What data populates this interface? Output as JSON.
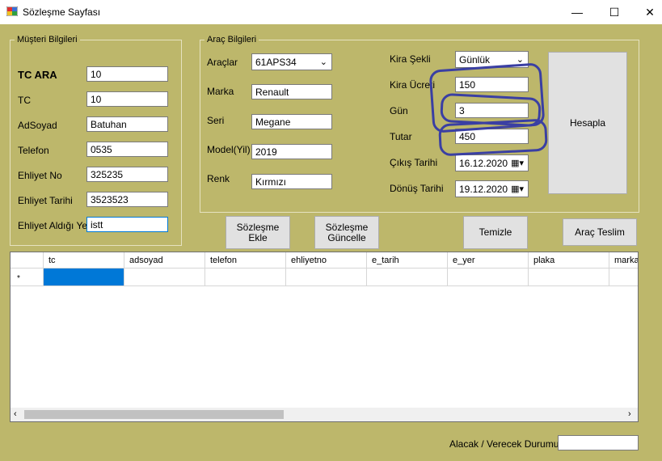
{
  "window": {
    "title": "Sözleşme Sayfası",
    "minimize": "—",
    "maximize": "☐",
    "close": "✕"
  },
  "musteri": {
    "group_label": "Müşteri Bilgileri",
    "tc_ara_label": "TC ARA",
    "tc_ara_value": "10",
    "tc_label": "TC",
    "tc_value": "10",
    "adsoyad_label": "AdSoyad",
    "adsoyad_value": "Batuhan",
    "telefon_label": "Telefon",
    "telefon_value": "0535",
    "ehliyet_no_label": "Ehliyet No",
    "ehliyet_no_value": "325235",
    "ehliyet_tarihi_label": "Ehliyet Tarihi",
    "ehliyet_tarihi_value": "3523523",
    "ehliyet_yer_label": "Ehliyet Aldığı Yer",
    "ehliyet_yer_value": "istt"
  },
  "arac": {
    "group_label": "Araç Bilgileri",
    "araclar_label": "Araçlar",
    "araclar_value": "61APS34",
    "marka_label": "Marka",
    "marka_value": "Renault",
    "seri_label": "Seri",
    "seri_value": "Megane",
    "model_label": "Model(Yil)",
    "model_value": "2019",
    "renk_label": "Renk",
    "renk_value": "Kırmızı"
  },
  "kira": {
    "sekli_label": "Kira Şekli",
    "sekli_value": "Günlük",
    "ucreti_label": "Kira Ücreti",
    "ucreti_value": "150",
    "gun_label": "Gün",
    "gun_value": "3",
    "tutar_label": "Tutar",
    "tutar_value": "450",
    "cikis_label": "Çıkış Tarihi",
    "cikis_value": "16.12.2020",
    "donus_label": "Dönüş Tarihi",
    "donus_value": "19.12.2020"
  },
  "buttons": {
    "hesapla": "Hesapla",
    "sozlesme_ekle_1": "Sözleşme",
    "sozlesme_ekle_2": "Ekle",
    "sozlesme_guncelle_1": "Sözleşme",
    "sozlesme_guncelle_2": "Güncelle",
    "temizle": "Temizle",
    "arac_teslim": "Araç Teslim"
  },
  "grid": {
    "columns": [
      "tc",
      "adsoyad",
      "telefon",
      "ehliyetno",
      "e_tarih",
      "e_yer",
      "plaka",
      "marka"
    ],
    "new_row_marker": "*"
  },
  "footer": {
    "alacak_label": "Alacak / Verecek Durumu",
    "alacak_value": ""
  },
  "colors": {
    "form_bg": "#bdb76b",
    "annotation": "#3a3fa3",
    "selection": "#0078d7"
  }
}
